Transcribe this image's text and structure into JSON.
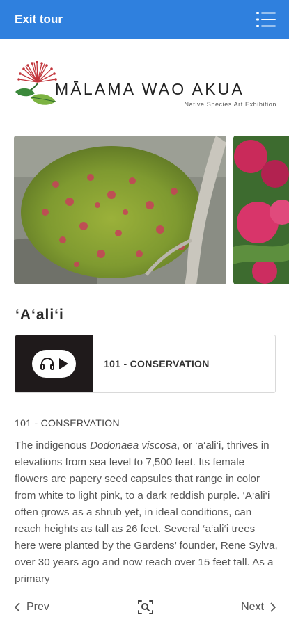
{
  "header": {
    "exit_label": "Exit tour",
    "menu_icon": "list-menu-icon",
    "bar_color": "#2f80de"
  },
  "logo": {
    "title": "MĀLAMA WAO AKUA",
    "subtitle": "Native Species Art Exhibition",
    "icon": "lehua-blossom-icon"
  },
  "carousel": {
    "slides": [
      "aali-shrub-photo",
      "pink-flower-photo"
    ]
  },
  "plant": {
    "title": "ʻAʻaliʻi"
  },
  "audio": {
    "label": "101 - CONSERVATION",
    "icons": [
      "headphones-icon",
      "play-icon"
    ]
  },
  "content": {
    "heading": "101 - CONSERVATION",
    "text_before": "The indigenous ",
    "text_italic": "Dodonaea viscosa",
    "text_after": ", or ‘a‘ali‘i, thrives in elevations from sea level to 7,500 feet. Its female flowers are papery seed capsules that range in color from white to light pink, to a dark reddish purple. ‘A‘ali‘i often grows as a shrub yet, in ideal conditions, can reach heights as tall as 26 feet. Several ‘a‘ali‘i trees here were planted by the Gardens’ founder, Rene Sylva, over 30 years ago and now reach over 15 feet tall. As a primary"
  },
  "footer": {
    "prev_label": "Prev",
    "next_label": "Next",
    "scan_icon": "scan-search-icon"
  }
}
